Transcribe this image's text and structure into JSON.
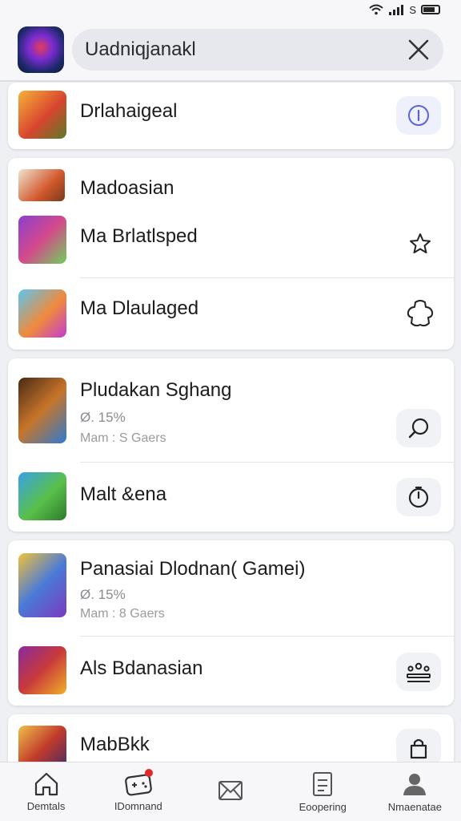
{
  "status_bar": {
    "signal_text": "S",
    "battery_text": ""
  },
  "header": {
    "search_value": "Uadniqjanakl"
  },
  "cards": [
    {
      "items": [
        {
          "title": "Drlahaigeal",
          "action_icon": "info-icon"
        }
      ]
    },
    {
      "items": [
        {
          "title": "Madoasian"
        },
        {
          "title": "Ma Brlatlsped",
          "action_icon": "star-outline-icon"
        },
        {
          "title": "Ma Dlaulaged",
          "action_icon": "puzzle-outline-icon"
        }
      ]
    },
    {
      "items": [
        {
          "title": "Pludakan Sghang",
          "rating": "Ø. 15%",
          "players": "Mam : S Gaers",
          "action_icon": "search-icon"
        },
        {
          "title": "Malt &ena",
          "action_icon": "clock-icon"
        }
      ]
    },
    {
      "items": [
        {
          "title": "Panasiai Dlodnan( Gamei)",
          "rating": "Ø. 15%",
          "players": "Mam : 8 Gaers",
          "action_icon": "crown-icon"
        },
        {
          "title": "Als Bdanasian",
          "action_icon": "podium-icon"
        }
      ]
    },
    {
      "items": [
        {
          "title": "MabBkk",
          "action_icon": "bag-icon"
        }
      ]
    }
  ],
  "bottom_nav": [
    {
      "label": "Demtals",
      "icon": "home-icon"
    },
    {
      "label": "IDomnand",
      "icon": "controller-icon",
      "badge": true
    },
    {
      "label": "",
      "icon": "mail-icon"
    },
    {
      "label": "Eoopering",
      "icon": "document-icon"
    },
    {
      "label": "Nmaenatae",
      "icon": "profile-icon"
    }
  ],
  "colors": {
    "accent": "#5a64d8",
    "badge": "#e02a2a",
    "background": "#eef0f4",
    "card": "#ffffff"
  }
}
